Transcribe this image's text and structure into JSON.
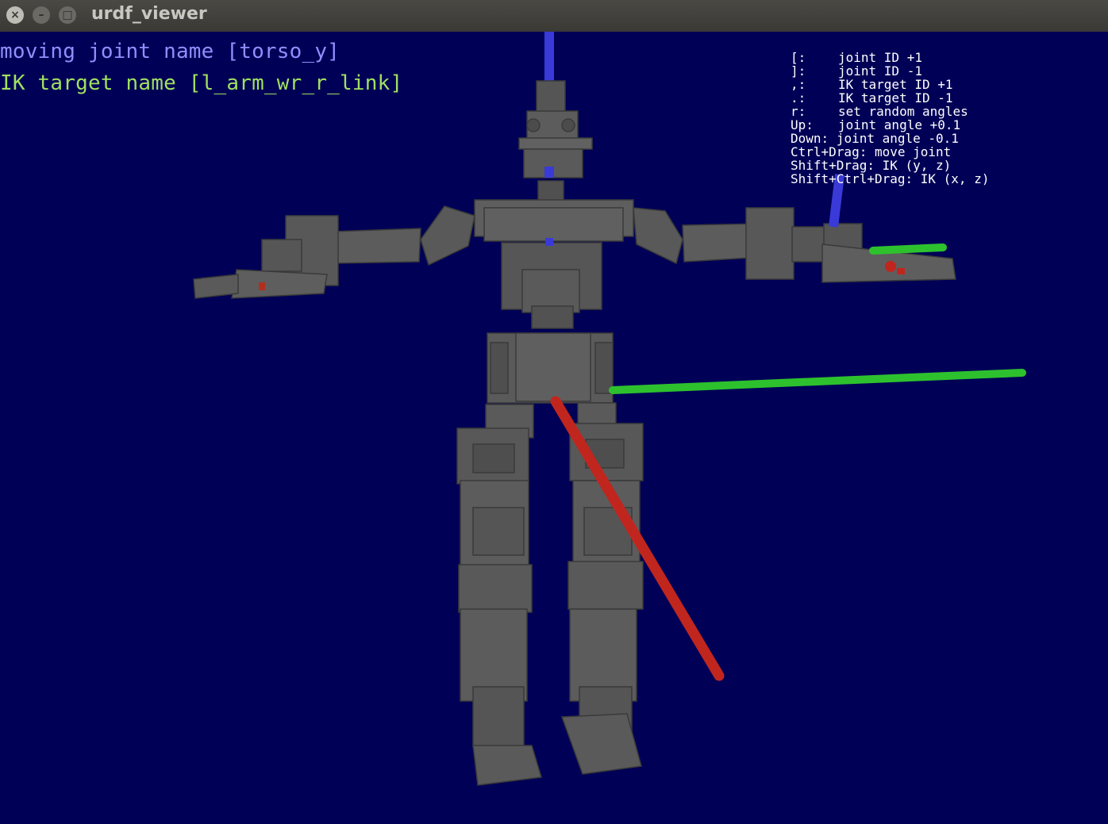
{
  "window": {
    "title": "urdf_viewer",
    "close_glyph": "×",
    "minimize_glyph": "–",
    "maximize_glyph": "□"
  },
  "hud": {
    "moving_joint": "moving joint name [torso_y]",
    "ik_target": "IK target name [l_arm_wr_r_link]",
    "joint_color": "#8f8fff",
    "ik_color": "#a0e060"
  },
  "help": [
    {
      "key": "[:",
      "action": "joint ID +1"
    },
    {
      "key": "]:",
      "action": "joint ID -1"
    },
    {
      "key": ",:",
      "action": "IK target ID +1"
    },
    {
      "key": ".:",
      "action": "IK target ID -1"
    },
    {
      "key": "r:",
      "action": "set random angles"
    },
    {
      "key": "Up:",
      "action": "joint angle +0.1"
    },
    {
      "key": "Down:",
      "action": "joint angle -0.1"
    },
    {
      "key": "Ctrl+Drag:",
      "action": "move joint"
    },
    {
      "key": "Shift+Drag:",
      "action": "IK (y, z)"
    },
    {
      "key": "Shift+Ctrl+Drag:",
      "action": "IK (x, z)"
    }
  ],
  "scene": {
    "background": "#000056",
    "robot_color": "#5a5a5a",
    "axis_colors": {
      "x": "#c0261e",
      "y": "#2ec12e",
      "z": "#3a3ad8"
    }
  }
}
